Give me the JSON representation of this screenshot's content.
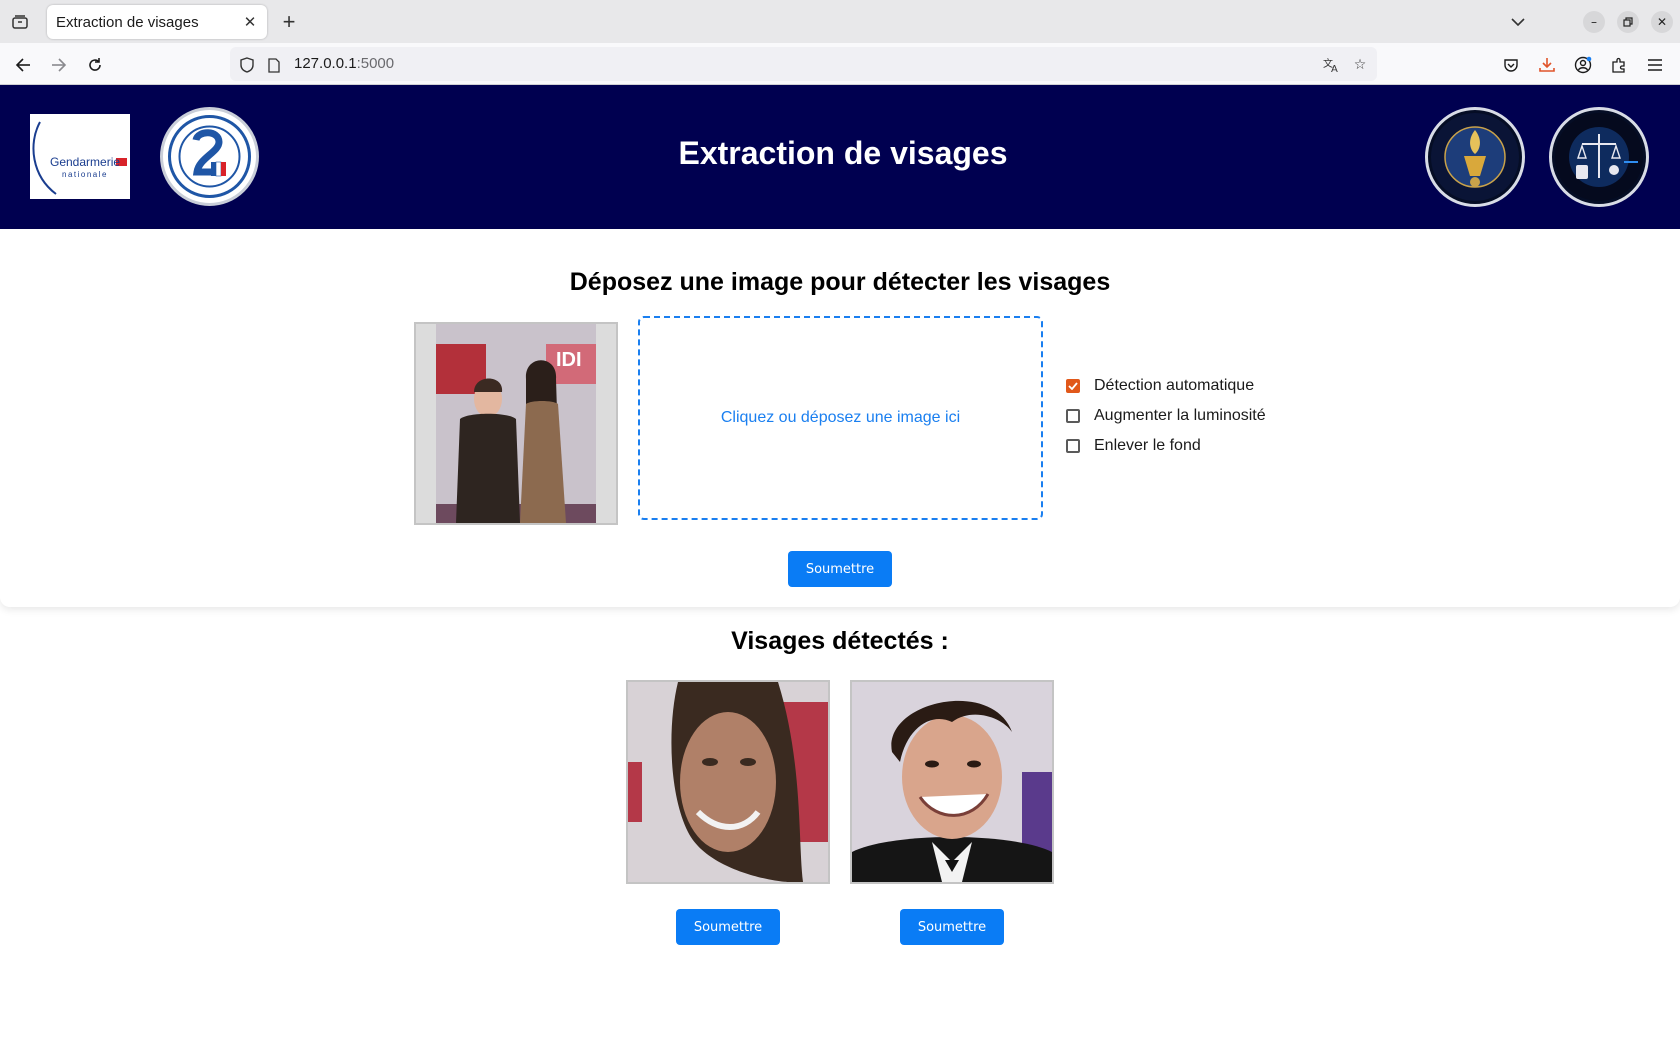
{
  "browser": {
    "tab_title": "Extraction de visages",
    "url_host": "127.0.0.1",
    "url_port": ":5000"
  },
  "header": {
    "title": "Extraction de visages",
    "logo_gendarmerie_line1": "Gendarmerie",
    "logo_gendarmerie_line2": "nationale"
  },
  "upload": {
    "title": "Déposez une image pour détecter les visages",
    "dropzone_text": "Cliquez ou déposez une image ici",
    "options": [
      {
        "label": "Détection automatique",
        "checked": true
      },
      {
        "label": "Augmenter la luminosité",
        "checked": false
      },
      {
        "label": "Enlever le fond",
        "checked": false
      }
    ],
    "submit_label": "Soumettre"
  },
  "results": {
    "title": "Visages détectés :",
    "faces": [
      {
        "submit_label": "Soumettre"
      },
      {
        "submit_label": "Soumettre"
      }
    ]
  },
  "colors": {
    "header_bg": "#000050",
    "accent_blue": "#0a7cf5",
    "checkbox_checked": "#e1581a"
  }
}
